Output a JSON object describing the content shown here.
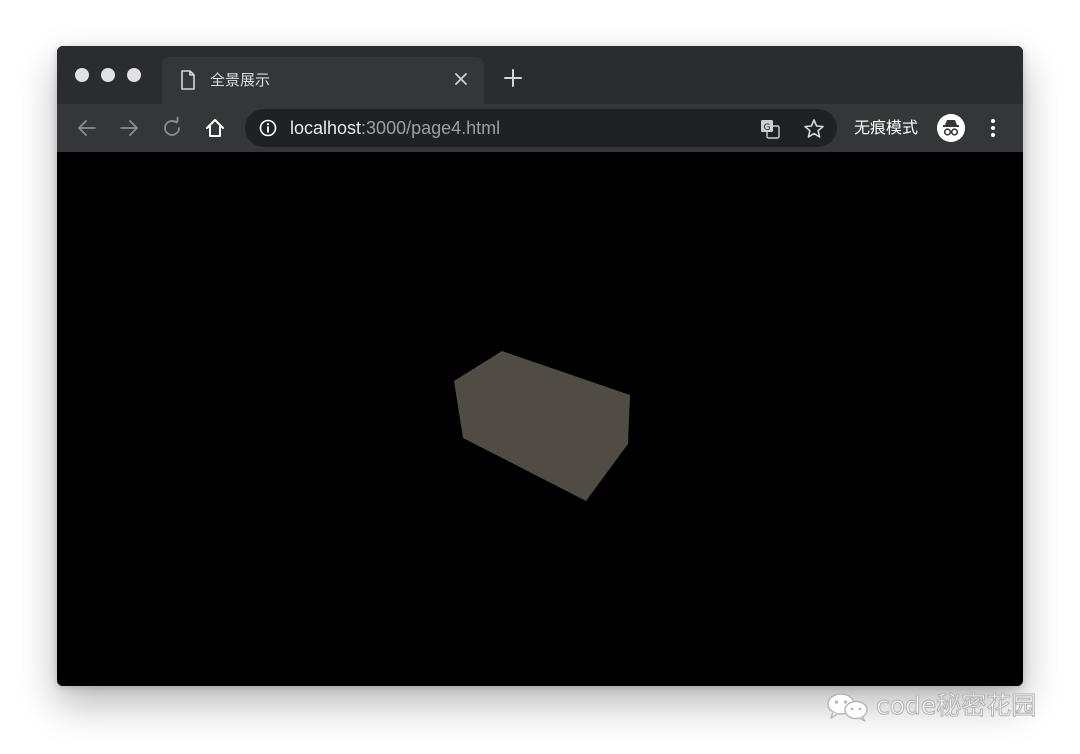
{
  "tab": {
    "title": "全景展示",
    "close_label": "×"
  },
  "address_bar": {
    "host": "localhost",
    "path": ":3000/page4.html"
  },
  "toolbar": {
    "incognito_label": "无痕模式"
  },
  "scene": {
    "box_face_color": "#514c43",
    "background_color": "#000000"
  },
  "watermark": {
    "text": "code秘密花园"
  },
  "colors": {
    "titlebar": "#2a2c30",
    "toolbar": "#35363a",
    "omnibox": "#202124"
  },
  "icons": [
    "page-icon",
    "close-icon",
    "plus-icon",
    "back-arrow-icon",
    "forward-arrow-icon",
    "reload-icon",
    "home-icon",
    "info-icon",
    "translate-icon",
    "star-icon",
    "incognito-icon",
    "more-vert-icon",
    "wechat-icon"
  ]
}
